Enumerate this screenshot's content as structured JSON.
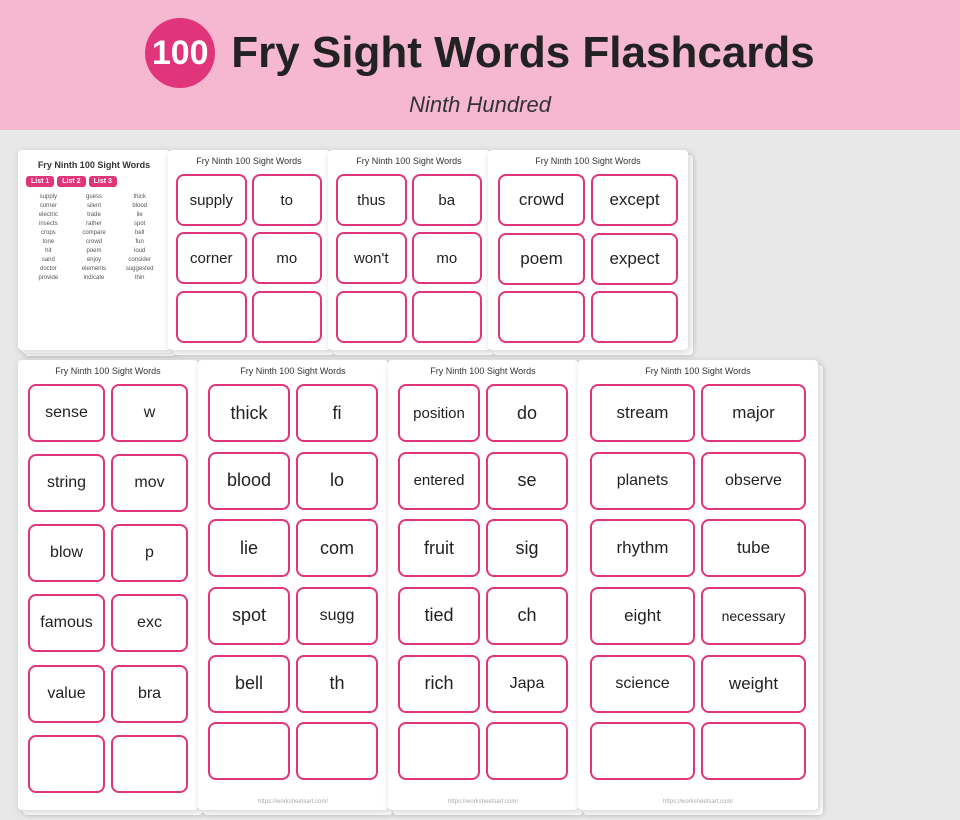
{
  "header": {
    "badge": "100",
    "title": "Fry Sight Words Flashcards",
    "subtitle": "Ninth Hundred"
  },
  "list_card": {
    "title": "Fry Ninth 100 Sight Words",
    "badges": [
      "List 1",
      "List 2",
      "List 3"
    ],
    "col1": [
      "supply",
      "corner",
      "electric",
      "insects",
      "crops",
      "tone",
      "hit",
      "sand",
      "doctor",
      "provide"
    ],
    "col2": [
      "guess",
      "silent",
      "trade",
      "rather",
      "compare",
      "crowd",
      "poem",
      "enjoy",
      "elements",
      "indicate"
    ],
    "col3": [
      "thick",
      "blood",
      "lie",
      "spot",
      "bell",
      "fun",
      "loud",
      "consider",
      "suggested",
      "thin"
    ]
  },
  "sheet1": {
    "title": "Fry Ninth 100 Sight Words",
    "words": [
      "supply",
      "to",
      "corner",
      "mo",
      "",
      "",
      "",
      "",
      "",
      "",
      "",
      ""
    ],
    "url": ""
  },
  "sheet2": {
    "title": "Fry Ninth 100 Sight Words",
    "words": [
      "thus",
      "ba",
      "won't",
      "mo",
      "",
      "",
      "",
      "",
      "",
      "",
      "",
      ""
    ],
    "url": ""
  },
  "sheet3": {
    "title": "Fry Ninth 100 Sight Words",
    "words": [
      "crowd",
      "except",
      "poem",
      "expect",
      "",
      "",
      "",
      "",
      "",
      "",
      "",
      ""
    ],
    "url": ""
  },
  "sheet4": {
    "title": "Fry Ninth 100 Sight Words",
    "words": [
      "sense",
      "w",
      "string",
      "mov",
      "blow",
      "p",
      "famous",
      "exc",
      "value",
      "bra",
      "",
      ""
    ],
    "url": ""
  },
  "sheet5": {
    "title": "Fry Ninth 100 Sight Words",
    "words": [
      "thick",
      "fi",
      "blood",
      "lo",
      "lie",
      "com",
      "spot",
      "sugg",
      "bell",
      "th",
      "",
      ""
    ],
    "url": "https://worksheetsart.com/"
  },
  "sheet6": {
    "title": "Fry Ninth 100 Sight Words",
    "words": [
      "position",
      "do",
      "entered",
      "se",
      "fruit",
      "sig",
      "tied",
      "ch",
      "rich",
      "Japa",
      "",
      ""
    ],
    "url": "https://worksheetsart.com/"
  },
  "sheet7": {
    "title": "Fry Ninth 100 Sight Words",
    "words": [
      "stream",
      "major",
      "planets",
      "observe",
      "rhythm",
      "tube",
      "eight",
      "necessary",
      "science",
      "weight",
      "",
      ""
    ],
    "url": "https://worksheetsart.com/"
  }
}
